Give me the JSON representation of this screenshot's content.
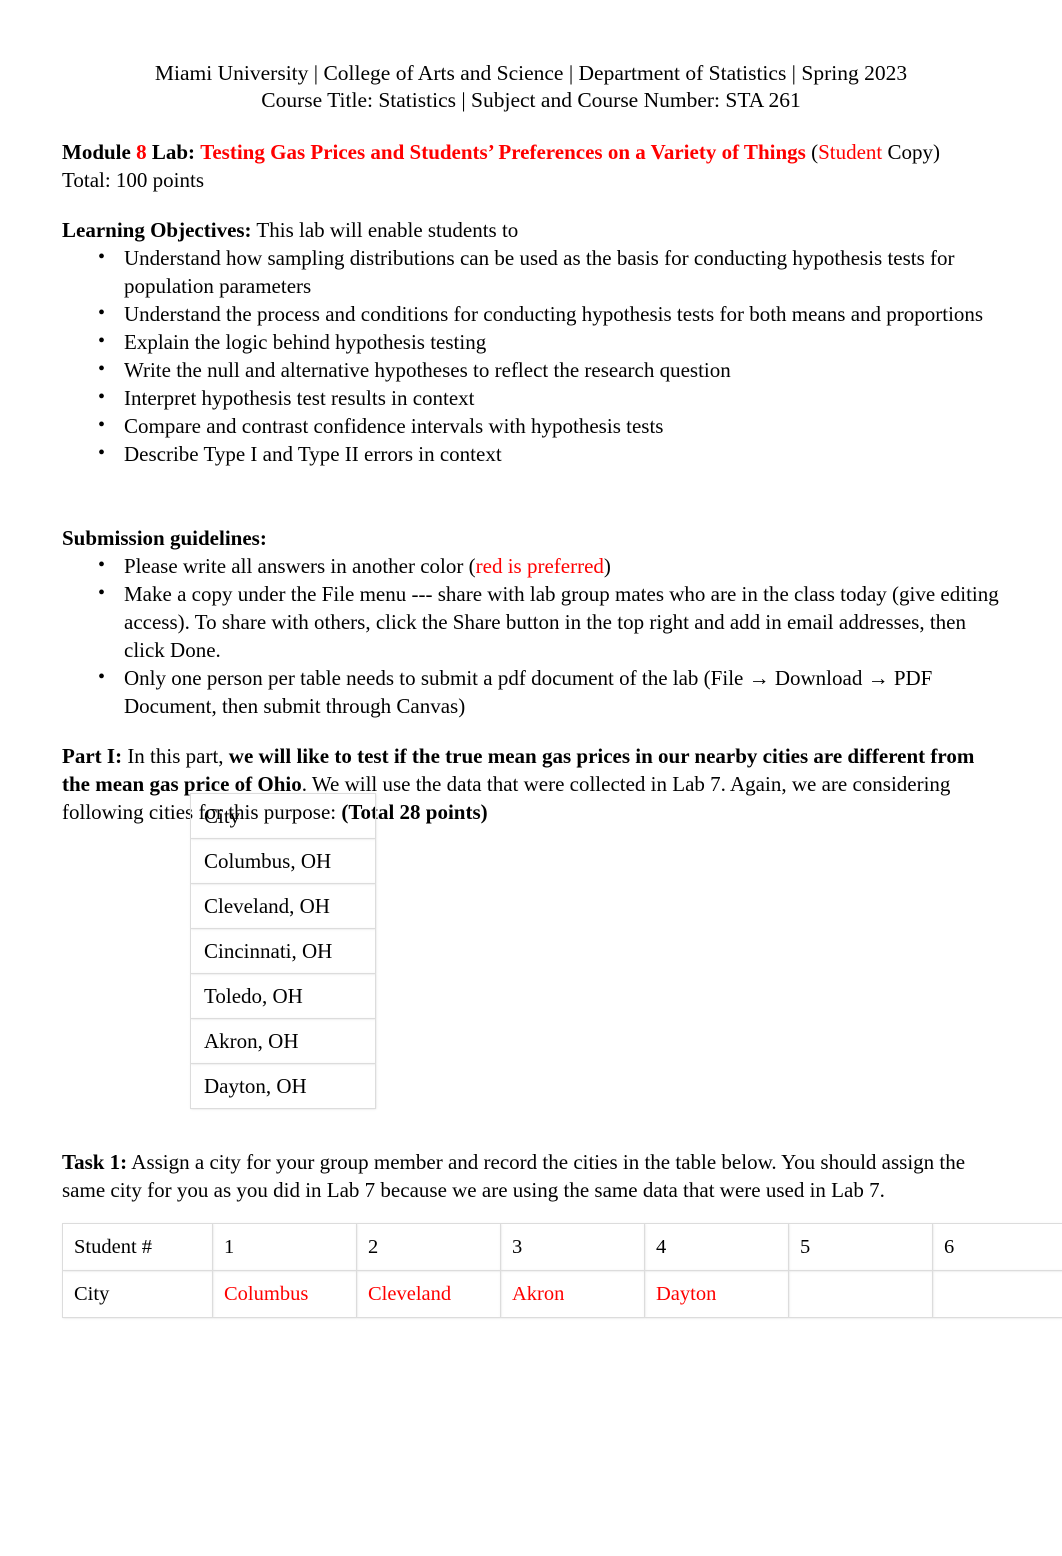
{
  "header": {
    "line1": "Miami University | College of Arts and Science | Department of Statistics | Spring 2023",
    "line2": "Course Title: Statistics | Subject and Course Number: STA 261"
  },
  "title": {
    "module_word": "Module",
    "module_number": "8",
    "lab_word": "Lab:",
    "lab_title": "Testing Gas Prices and Students’ Preferences on a Variety of Things",
    "open_paren": "(",
    "student_word": "Student",
    "copy_word": " Copy)",
    "total_points": "Total: 100 points"
  },
  "learning_objectives": {
    "heading": "Learning Objectives:",
    "lead": " This lab will enable students to",
    "items": [
      "Understand how sampling distributions can be used as the basis for conducting hypothesis tests for population parameters",
      "Understand the process and conditions for conducting hypothesis tests for both means and proportions",
      "Explain the logic behind hypothesis testing",
      "Write the null and alternative hypotheses to reflect the research question",
      "Interpret hypothesis test results in context",
      "Compare and contrast confidence intervals with hypothesis tests",
      "Describe Type I and Type II errors in context"
    ]
  },
  "submission": {
    "heading": "Submission guidelines:",
    "item1_pre": "Please write all answers in another color (",
    "item1_red": "red is preferred",
    "item1_post": ")",
    "item2": "Make a copy under the File menu --- share with lab group mates who are in the class today (give editing access). To share with others, click the Share button in the top right and add in email addresses, then click Done.",
    "item3": "Only one person per table needs to submit a pdf document of the lab (File → Download → PDF Document, then submit through Canvas)"
  },
  "part1": {
    "label": "Part I:",
    "text_a": " In this part, ",
    "bold_a": "we will like to test if the true mean gas prices in our nearby cities are different from the mean gas price of Ohio",
    "text_b": ". We will use the data that were collected in Lab 7. Again, we are considering following cities for this purpose: ",
    "bold_b": "(Total 28 points)"
  },
  "city_table": {
    "header": "City",
    "rows": [
      "Columbus, OH",
      "Cleveland, OH",
      "Cincinnati, OH",
      "Toledo, OH",
      "Akron, OH",
      "Dayton, OH"
    ]
  },
  "task1": {
    "label": "Task 1:",
    "text": " Assign a city for your group member and record the cities in the table below. You should assign the same city for you as you did in Lab 7 because we are using the same data that were used in Lab 7."
  },
  "student_table": {
    "row_labels": [
      "Student #",
      "City"
    ],
    "student_numbers": [
      "1",
      "2",
      "3",
      "4",
      "5",
      "6"
    ],
    "cities": [
      "Columbus",
      "Cleveland",
      "Akron",
      "Dayton",
      "",
      ""
    ]
  },
  "colors": {
    "accent_red": "#ff0000",
    "text": "#000000",
    "table_border": "#dcdcdc"
  }
}
